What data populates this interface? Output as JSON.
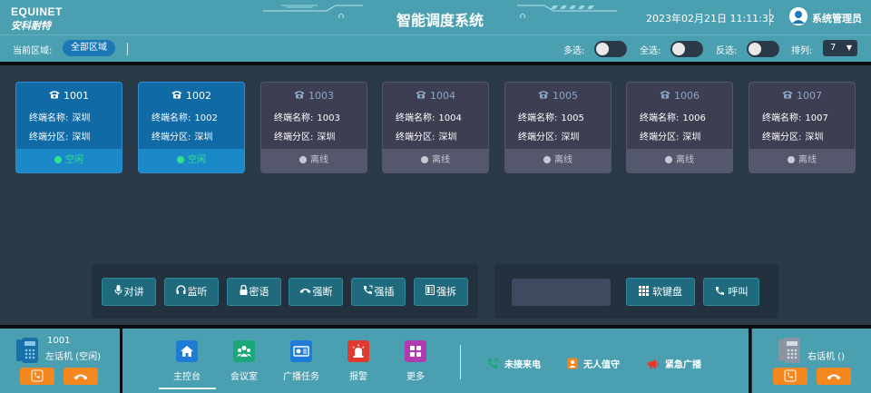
{
  "header": {
    "logo_en": "EQUINET",
    "logo_cn": "安科耐特",
    "title": "智能调度系统",
    "datetime": "2023年02月21日 11:11:32",
    "user": "系统管理员",
    "bg_color": "#4a9fb0"
  },
  "toolbar": {
    "region_label": "当前区域:",
    "region_value": "全部区域",
    "multi_select": "多选:",
    "select_all": "全选:",
    "invert": "反选:",
    "sort_label": "排列:",
    "sort_value": "7"
  },
  "terminals": [
    {
      "id": "1001",
      "name_label": "终端名称:",
      "name": "深圳",
      "zone_label": "终端分区:",
      "zone": "深圳",
      "status": "空闲",
      "online": true
    },
    {
      "id": "1002",
      "name_label": "终端名称:",
      "name": "1002",
      "zone_label": "终端分区:",
      "zone": "深圳",
      "status": "空闲",
      "online": true
    },
    {
      "id": "1003",
      "name_label": "终端名称:",
      "name": "1003",
      "zone_label": "终端分区:",
      "zone": "深圳",
      "status": "离线",
      "online": false
    },
    {
      "id": "1004",
      "name_label": "终端名称:",
      "name": "1004",
      "zone_label": "终端分区:",
      "zone": "深圳",
      "status": "离线",
      "online": false
    },
    {
      "id": "1005",
      "name_label": "终端名称:",
      "name": "1005",
      "zone_label": "终端分区:",
      "zone": "深圳",
      "status": "离线",
      "online": false
    },
    {
      "id": "1006",
      "name_label": "终端名称:",
      "name": "1006",
      "zone_label": "终端分区:",
      "zone": "深圳",
      "status": "离线",
      "online": false
    },
    {
      "id": "1007",
      "name_label": "终端名称:",
      "name": "1007",
      "zone_label": "终端分区:",
      "zone": "深圳",
      "status": "离线",
      "online": false
    }
  ],
  "controls": {
    "intercom": "对讲",
    "monitor": "监听",
    "whisper": "密语",
    "force_break": "强断",
    "force_insert": "强插",
    "force_split": "强拆",
    "keypad": "软键盘",
    "call": "呼叫"
  },
  "left_phone": {
    "number": "1001",
    "name": "左话机 (空闲)"
  },
  "right_phone": {
    "name": "右话机 ()"
  },
  "nav": {
    "console": "主控台",
    "meeting": "会议室",
    "broadcast": "广播任务",
    "alarm": "报警",
    "more": "更多"
  },
  "status": {
    "missed": "未接来电",
    "unattended": "无人值守",
    "emergency": "紧急广播"
  },
  "colors": {
    "online_card": "#0f6aa6",
    "offline_card": "#3e3e52",
    "idle_green": "#2ee38f",
    "orange": "#f5871f"
  }
}
